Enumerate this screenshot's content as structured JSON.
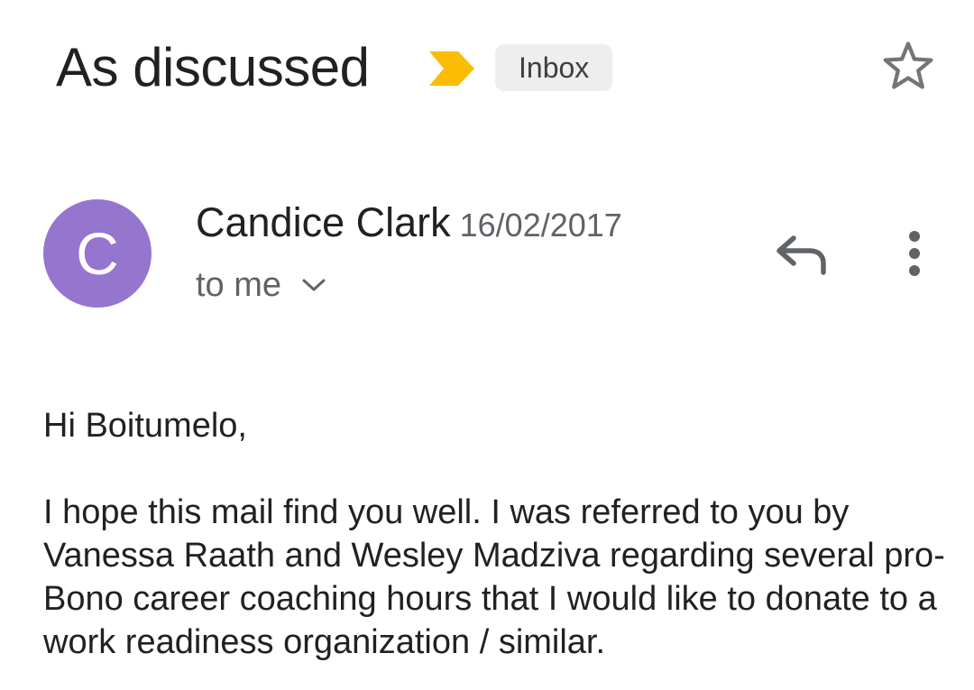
{
  "header": {
    "subject": "As discussed",
    "label": "Inbox",
    "icons": {
      "importance": "importance-marker-icon",
      "star": "star-outline-icon"
    },
    "colors": {
      "importance": "#fbbc04",
      "label_bg": "#eeeeee"
    }
  },
  "sender": {
    "avatar_letter": "C",
    "avatar_color": "#9575cd",
    "name": "Candice Clark",
    "date": "16/02/2017",
    "recipient": "to me",
    "icons": {
      "expand": "chevron-down-icon",
      "reply": "reply-icon",
      "more": "more-vert-icon"
    }
  },
  "message": {
    "greeting": "Hi Boitumelo,",
    "paragraph": "I hope this mail find you well. I was referred to you by Vanessa Raath and Wesley Madziva regarding several pro-Bono career coaching hours that I would like to donate to a work readiness organization / similar."
  }
}
